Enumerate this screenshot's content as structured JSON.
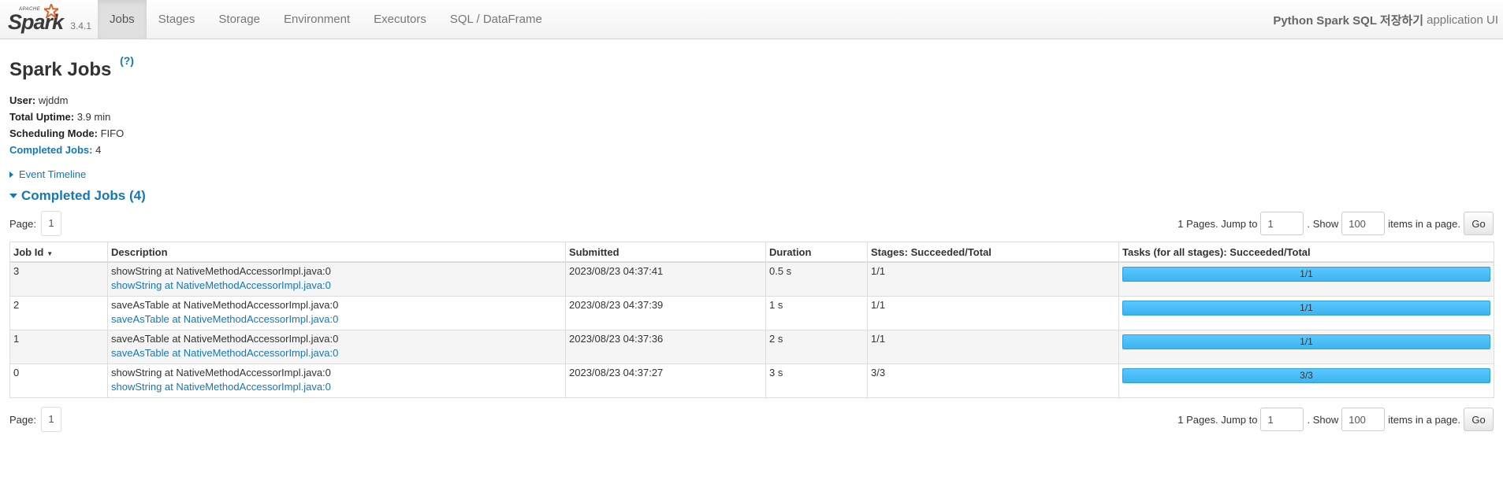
{
  "navbar": {
    "logo_apache": "APACHE",
    "logo_word": "Spark",
    "version": "3.4.1",
    "tabs": [
      {
        "label": "Jobs",
        "active": true
      },
      {
        "label": "Stages"
      },
      {
        "label": "Storage"
      },
      {
        "label": "Environment"
      },
      {
        "label": "Executors"
      },
      {
        "label": "SQL / DataFrame"
      }
    ],
    "app_name": "Python Spark SQL 저장하기",
    "app_suffix": "application UI"
  },
  "page": {
    "title": "Spark Jobs",
    "help": "(?)"
  },
  "summary": {
    "user_label": "User:",
    "user_value": "wjddm",
    "uptime_label": "Total Uptime:",
    "uptime_value": "3.9 min",
    "mode_label": "Scheduling Mode:",
    "mode_value": "FIFO",
    "completed_label": "Completed Jobs:",
    "completed_value": "4"
  },
  "event_timeline": "Event Timeline",
  "completed_section": "Completed Jobs (4)",
  "paging": {
    "page_label": "Page:",
    "current_page": "1",
    "pages_text": "1 Pages. Jump to",
    "jump_value": "1",
    "show_text": ". Show",
    "page_size": "100",
    "items_text": "items in a page.",
    "go": "Go"
  },
  "table": {
    "headers": [
      "Job Id",
      "Description",
      "Submitted",
      "Duration",
      "Stages: Succeeded/Total",
      "Tasks (for all stages): Succeeded/Total"
    ],
    "sort_indicator": "▼",
    "rows": [
      {
        "id": "3",
        "desc": "showString at NativeMethodAccessorImpl.java:0",
        "desc_link": "showString at NativeMethodAccessorImpl.java:0",
        "submitted": "2023/08/23 04:37:41",
        "duration": "0.5 s",
        "stages": "1/1",
        "tasks": "1/1",
        "progress": 1.0
      },
      {
        "id": "2",
        "desc": "saveAsTable at NativeMethodAccessorImpl.java:0",
        "desc_link": "saveAsTable at NativeMethodAccessorImpl.java:0",
        "submitted": "2023/08/23 04:37:39",
        "duration": "1 s",
        "stages": "1/1",
        "tasks": "1/1",
        "progress": 1.0
      },
      {
        "id": "1",
        "desc": "saveAsTable at NativeMethodAccessorImpl.java:0",
        "desc_link": "saveAsTable at NativeMethodAccessorImpl.java:0",
        "submitted": "2023/08/23 04:37:36",
        "duration": "2 s",
        "stages": "1/1",
        "tasks": "1/1",
        "progress": 1.0
      },
      {
        "id": "0",
        "desc": "showString at NativeMethodAccessorImpl.java:0",
        "desc_link": "showString at NativeMethodAccessorImpl.java:0",
        "submitted": "2023/08/23 04:37:27",
        "duration": "3 s",
        "stages": "3/3",
        "tasks": "3/3",
        "progress": 1.0
      }
    ]
  },
  "colors": {
    "link": "#1478b8",
    "progress": "#3ec0ff",
    "logo_star": "#e25a1c"
  }
}
